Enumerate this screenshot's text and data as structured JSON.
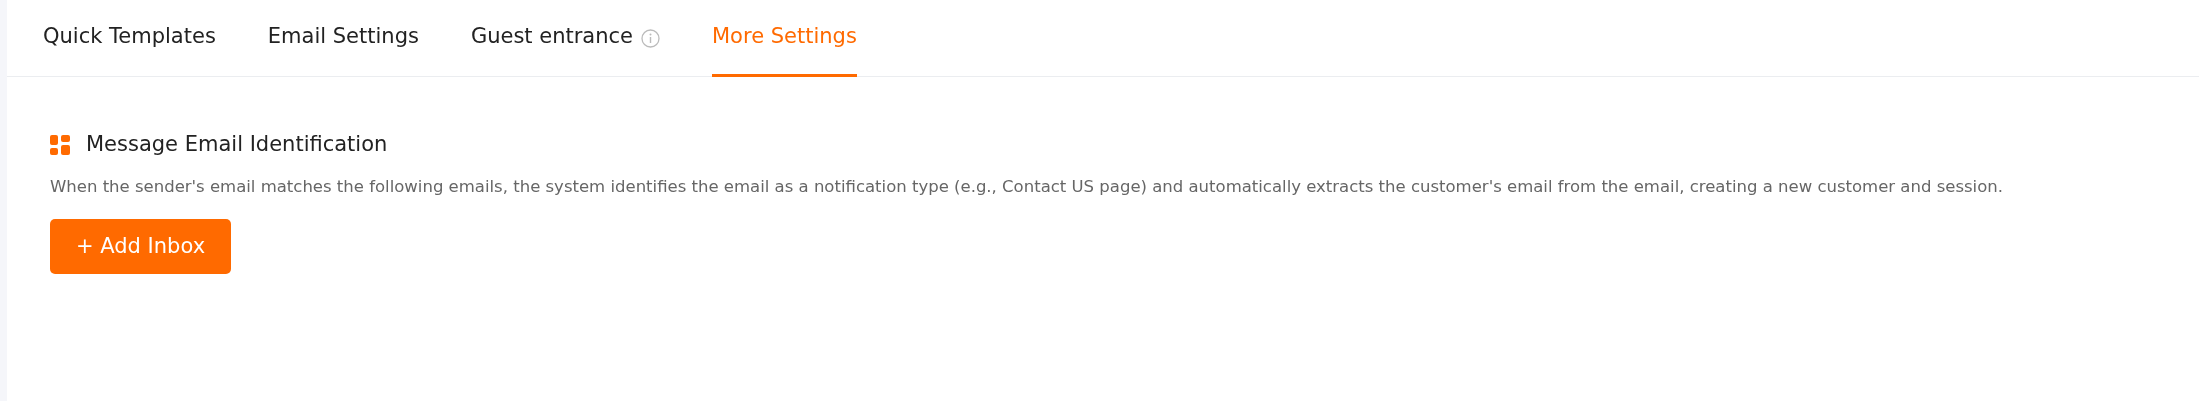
{
  "tabs": [
    {
      "label": "Quick Templates",
      "selected": false,
      "info": false
    },
    {
      "label": "Email Settings",
      "selected": false,
      "info": false
    },
    {
      "label": "Guest entrance",
      "selected": false,
      "info": true
    },
    {
      "label": "More Settings",
      "selected": true,
      "info": false
    }
  ],
  "section": {
    "title": "Message Email Identification",
    "description": "When the sender's email matches the following emails, the system identifies the email as a notification type (e.g., Contact US page) and automatically extracts the customer's email from the email, creating a new customer and session."
  },
  "buttons": [
    {
      "label": "+ Add Inbox"
    }
  ]
}
